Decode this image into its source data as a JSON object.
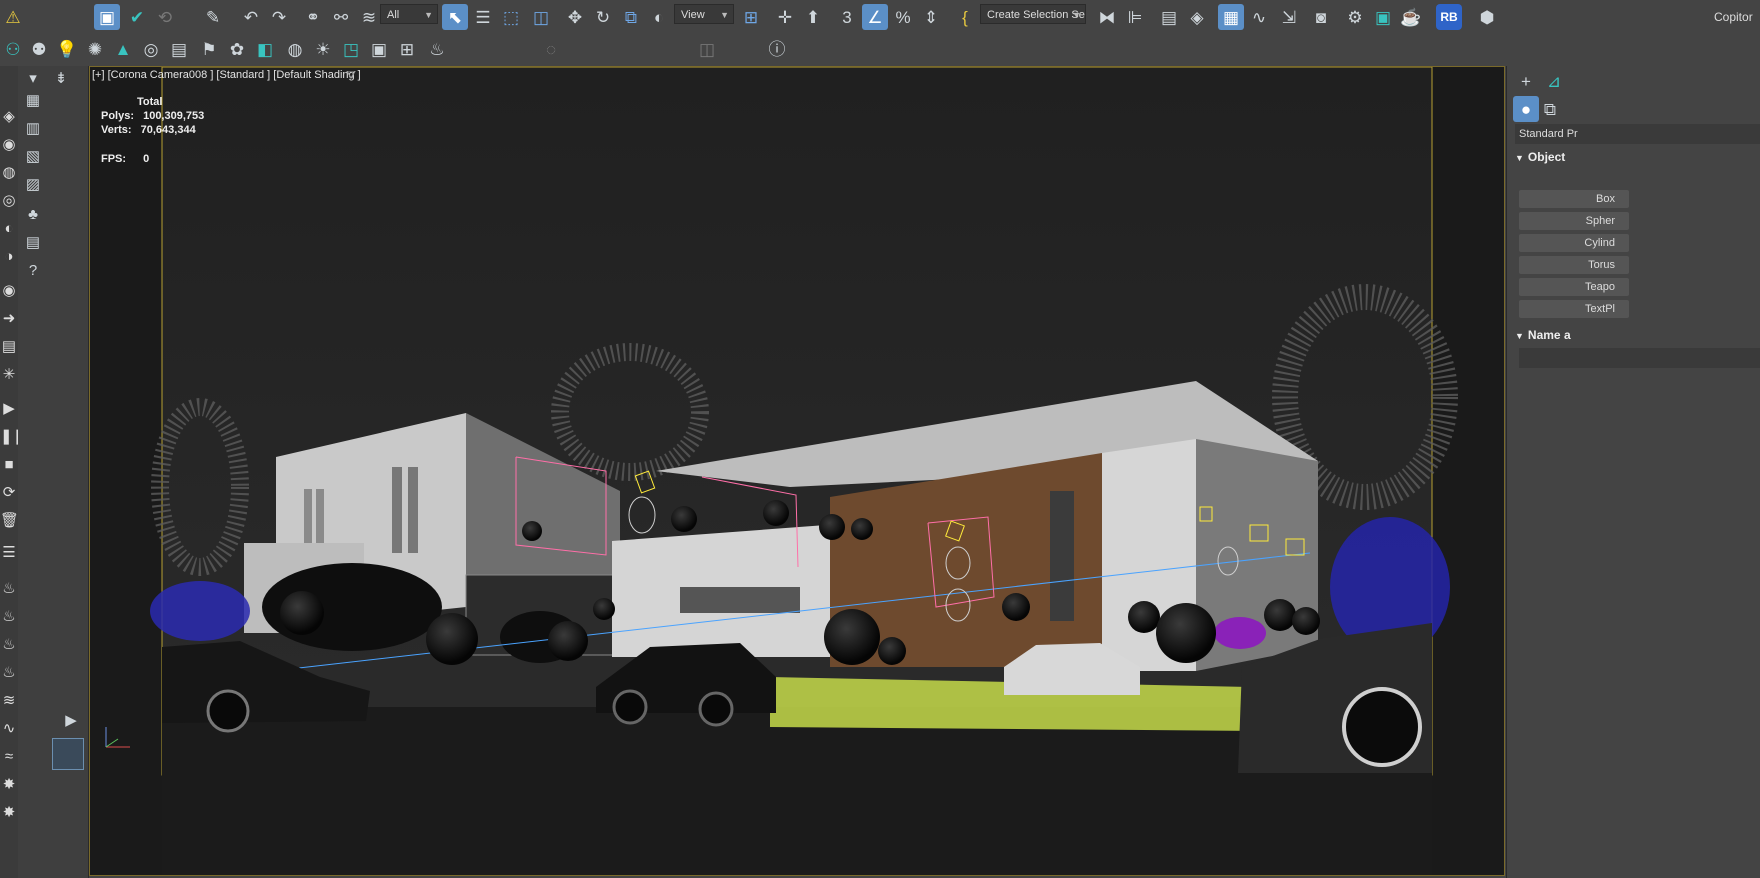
{
  "toolbar": {
    "selection_filter": "All",
    "reference_coord": "View",
    "named_selection": "Create Selection Se",
    "rb_badge": "RB",
    "copilot": "Copitor",
    "percent_snap": "%",
    "angle_snap": "3"
  },
  "viewport": {
    "label": "[+] [Corona Camera008 ] [Standard ] [Default Shading ]",
    "stats_total": "Total",
    "polys_label": "Polys:",
    "polys_value": "100,309,753",
    "verts_label": "Verts:",
    "verts_value": "70,643,344",
    "fps_label": "FPS:",
    "fps_value": "0"
  },
  "command_panel": {
    "category": "Standard Pr",
    "object_type_header": "Object",
    "buttons": [
      "Box",
      "Spher",
      "Cylind",
      "Torus",
      "Teapo",
      "TextPl"
    ],
    "name_header": "Name a"
  },
  "colors": {
    "accent_active": "#5b8fc7",
    "viewport_border": "#7a6a2a",
    "rb_badge": "#2f64c8"
  }
}
